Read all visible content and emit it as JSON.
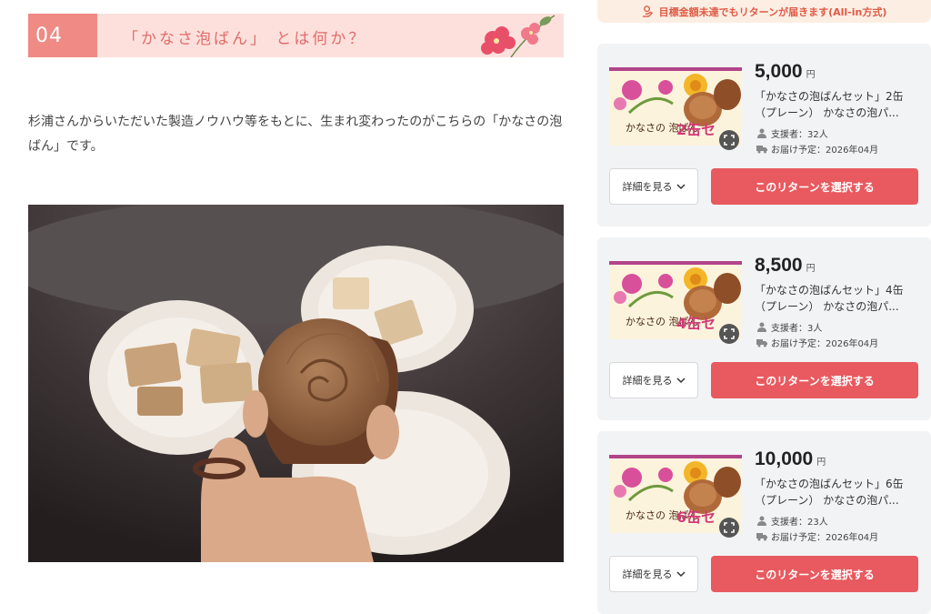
{
  "article": {
    "section_number": "04",
    "section_title": "「かなさ泡ばん」 とは何か？",
    "body_text": "杉浦さんからいただいた製造ノウハウ等をもとに、生まれ変わったのがこちらの「かなさの泡ばん」です。"
  },
  "sidebar": {
    "banner_text": "目標金額未達でもリターンが届きます(All-in方式)",
    "yen_label": "円",
    "detail_label": "詳細を見る",
    "select_label": "このリターンを選択する",
    "cards": [
      {
        "price": "5,000",
        "title": "「かなさの泡ばんセット」2缶（プレーン） かなさの泡パ...",
        "supporters": "支援者：32人",
        "delivery": "お届け予定：2026年04月",
        "thumb_logo": "かなさの 泡ばん",
        "thumb_count": "2缶セ"
      },
      {
        "price": "8,500",
        "title": "「かなさの泡ばんセット」4缶（プレーン） かなさの泡パ...",
        "supporters": "支援者：3人",
        "delivery": "お届け予定：2026年04月",
        "thumb_logo": "かなさの 泡ばん",
        "thumb_count": "4缶セ"
      },
      {
        "price": "10,000",
        "title": "「かなさの泡ばんセット」6缶（プレーン） かなさの泡パ...",
        "supporters": "支援者：23人",
        "delivery": "お届け予定：2026年04月",
        "thumb_logo": "かなさの 泡ばん",
        "thumb_count": "6缶セ"
      }
    ]
  },
  "colors": {
    "accent_red": "#e85a5f",
    "header_pink": "#fde0dc",
    "number_pink": "#ef8a84",
    "card_bg": "#f2f3f5"
  },
  "icons": [
    "flower-decoration",
    "money-bag-icon",
    "person-icon",
    "truck-icon",
    "zoom-icon",
    "chevron-down-icon"
  ]
}
